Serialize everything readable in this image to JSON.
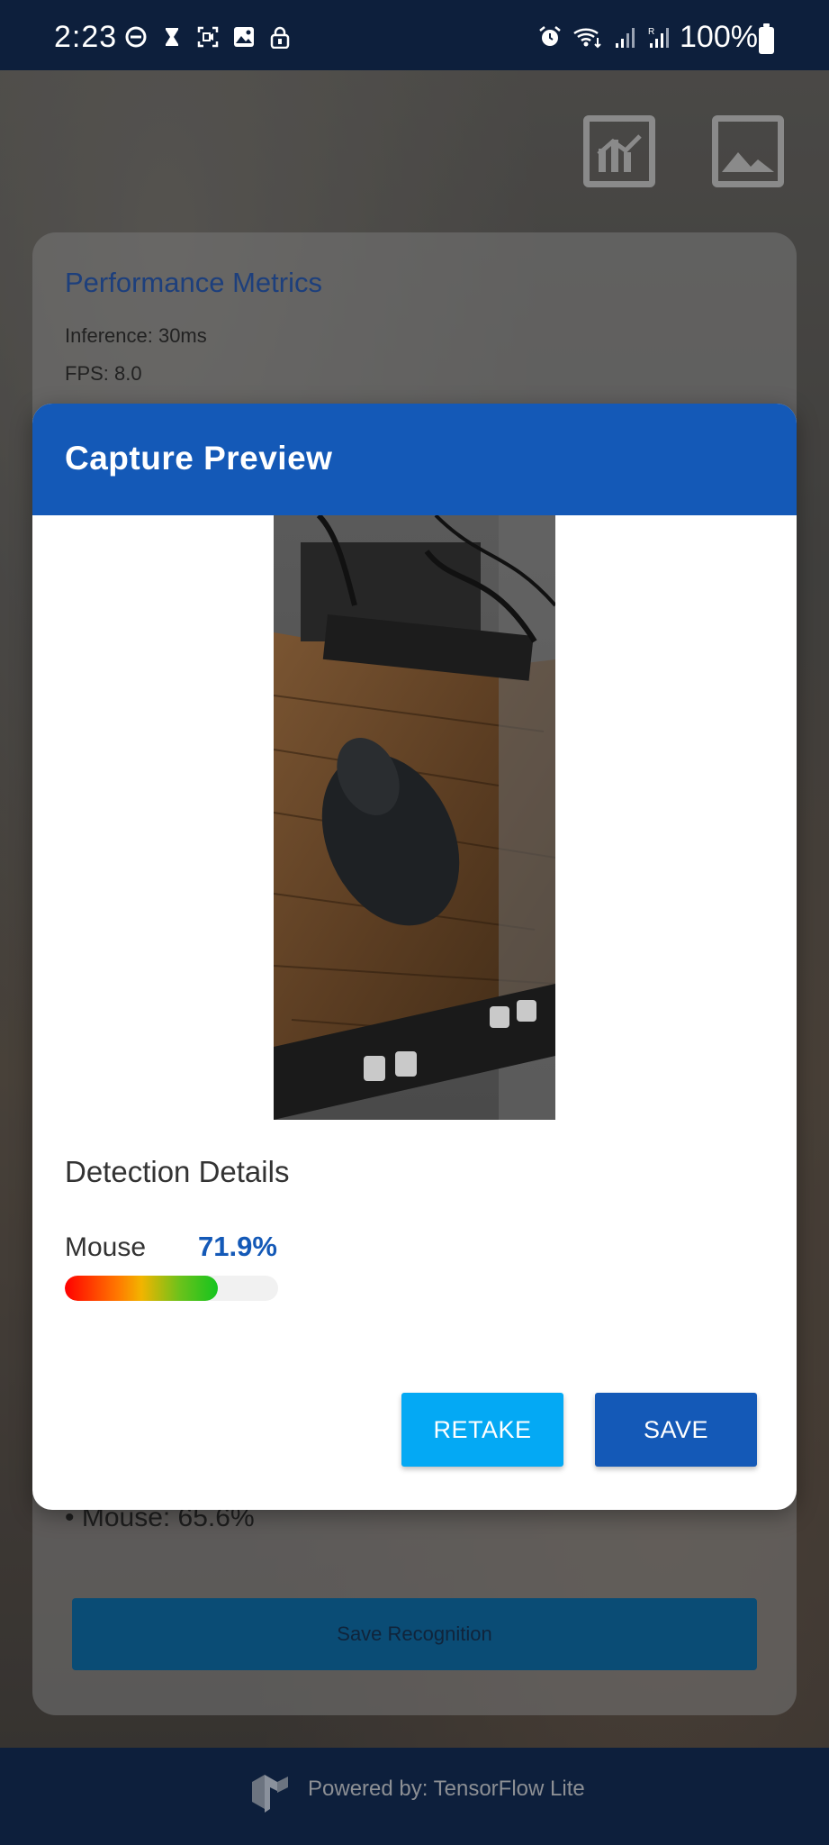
{
  "status_bar": {
    "time": "2:23",
    "battery": "100%",
    "left_icons": [
      "dnd-icon",
      "hourglass-icon",
      "screen-record-icon",
      "gallery-icon",
      "lock-icon"
    ],
    "right_icons": [
      "alarm-icon",
      "wifi-icon",
      "signal-icon",
      "roaming-signal-icon"
    ]
  },
  "top_toolbar": {
    "icons": [
      "chart-icon",
      "image-icon"
    ]
  },
  "background_card": {
    "title": "Performance Metrics",
    "inference": "Inference: 30ms",
    "fps": "FPS: 8.0",
    "detection_item": "• Mouse: 65.6%",
    "save_button": "Save Recognition"
  },
  "dialog": {
    "title": "Capture Preview",
    "details_title": "Detection Details",
    "detection": {
      "label": "Mouse",
      "value_text": "71.9%",
      "confidence": 0.719
    },
    "retake_label": "RETAKE",
    "save_label": "SAVE"
  },
  "footer": {
    "powered_by": "Powered by: TensorFlow Lite"
  },
  "colors": {
    "primary": "#1459b7",
    "accent": "#04a9f4",
    "bar_bg": "#0d1f3c"
  }
}
